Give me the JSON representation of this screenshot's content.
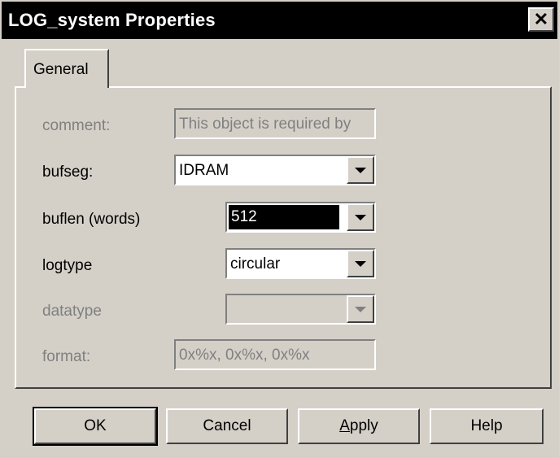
{
  "window": {
    "title": "LOG_system Properties",
    "close_glyph": "✕"
  },
  "tabs": [
    {
      "label": "General"
    }
  ],
  "form": {
    "comment": {
      "label": "comment:",
      "value": "This object is required by",
      "enabled": false
    },
    "bufseg": {
      "label": "bufseg:",
      "value": "IDRAM",
      "enabled": true
    },
    "buflen": {
      "label": "buflen (words)",
      "value": "512",
      "enabled": true,
      "selected": true
    },
    "logtype": {
      "label": "logtype",
      "value": "circular",
      "enabled": true
    },
    "datatype": {
      "label": "datatype",
      "value": "",
      "enabled": false
    },
    "format": {
      "label": "format:",
      "value": "0x%x, 0x%x, 0x%x",
      "enabled": false
    }
  },
  "buttons": {
    "ok": "OK",
    "cancel": "Cancel",
    "apply_accel": "A",
    "apply_rest": "pply",
    "help": "Help"
  },
  "icons": {
    "close": "close-icon",
    "dropdown": "chevron-down-icon"
  }
}
